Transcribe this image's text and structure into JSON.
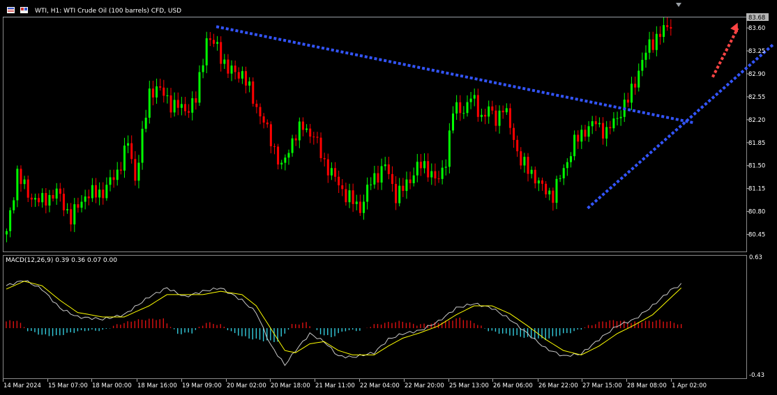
{
  "header": {
    "title": "WTI, H1:  WTI Crude Oil (100 barrels) CFD, USD"
  },
  "macd": {
    "label": "MACD(12,26,9) 0.39 0.36 0.07 0.00"
  },
  "colors": {
    "up": "#00ff00",
    "down": "#ff0000",
    "trendline": "#3355ff",
    "arrow": "#ff4444",
    "macd_line": "#c8c8c8",
    "signal_line": "#ffff00",
    "hist_pos": "#dd1111",
    "hist_neg": "#33ccdd"
  },
  "chart_data": [
    {
      "type": "candlestick",
      "title": "WTI, H1:  WTI Crude Oil (100 barrels) CFD, USD",
      "xlabel": "",
      "ylabel": "",
      "ylim": [
        80.2,
        83.75
      ],
      "y_ticks": [
        "83.60",
        "83.25",
        "82.90",
        "82.55",
        "82.20",
        "81.85",
        "81.50",
        "81.15",
        "80.80",
        "80.45"
      ],
      "y_tick_values": [
        83.6,
        83.25,
        82.9,
        82.55,
        82.2,
        81.85,
        81.5,
        81.15,
        80.8,
        80.45
      ],
      "current_price": "83.68",
      "x_tick_labels": [
        "14 Mar 2024",
        "15 Mar 07:00",
        "18 Mar 00:00",
        "18 Mar 16:00",
        "19 Mar 09:00",
        "20 Mar 02:00",
        "20 Mar 18:00",
        "21 Mar 11:00",
        "22 Mar 04:00",
        "22 Mar 20:00",
        "25 Mar 13:00",
        "26 Mar 06:00",
        "26 Mar 22:00",
        "27 Mar 15:00",
        "28 Mar 08:00",
        "1 Apr 02:00"
      ],
      "close_path": [
        [
          0,
          80.45
        ],
        [
          3,
          81.4
        ],
        [
          6,
          81.05
        ],
        [
          10,
          80.95
        ],
        [
          14,
          81.1
        ],
        [
          18,
          80.7
        ],
        [
          22,
          81.05
        ],
        [
          27,
          81.1
        ],
        [
          31,
          81.4
        ],
        [
          34,
          81.85
        ],
        [
          36,
          81.3
        ],
        [
          40,
          82.6
        ],
        [
          42,
          82.7
        ],
        [
          46,
          82.45
        ],
        [
          50,
          82.35
        ],
        [
          53,
          82.5
        ],
        [
          56,
          83.45
        ],
        [
          59,
          83.3
        ],
        [
          62,
          82.95
        ],
        [
          66,
          82.9
        ],
        [
          70,
          82.4
        ],
        [
          74,
          81.9
        ],
        [
          77,
          81.45
        ],
        [
          80,
          81.9
        ],
        [
          83,
          82.1
        ],
        [
          86,
          81.95
        ],
        [
          89,
          81.55
        ],
        [
          92,
          81.3
        ],
        [
          95,
          81.05
        ],
        [
          99,
          80.85
        ],
        [
          102,
          81.25
        ],
        [
          106,
          81.5
        ],
        [
          109,
          81.05
        ],
        [
          112,
          81.2
        ],
        [
          115,
          81.5
        ],
        [
          118,
          81.45
        ],
        [
          121,
          81.25
        ],
        [
          123,
          81.6
        ],
        [
          125,
          82.35
        ],
        [
          128,
          82.35
        ],
        [
          130,
          82.55
        ],
        [
          133,
          82.25
        ],
        [
          135,
          82.35
        ],
        [
          137,
          82.2
        ],
        [
          139,
          82.4
        ],
        [
          141,
          82.1
        ],
        [
          144,
          81.55
        ],
        [
          147,
          81.4
        ],
        [
          150,
          81.15
        ],
        [
          153,
          81.05
        ],
        [
          156,
          81.45
        ],
        [
          159,
          81.85
        ],
        [
          162,
          82.05
        ],
        [
          165,
          82.15
        ],
        [
          168,
          82.0
        ],
        [
          171,
          82.25
        ],
        [
          174,
          82.5
        ],
        [
          177,
          82.95
        ],
        [
          180,
          83.35
        ],
        [
          183,
          83.5
        ],
        [
          186,
          83.68
        ]
      ],
      "annotations": [
        {
          "type": "dotted-trendline",
          "color": "blue",
          "from": [
            59,
            83.62
          ],
          "to": [
            193,
            82.15
          ]
        },
        {
          "type": "dotted-trendline",
          "color": "blue",
          "from": [
            163,
            80.85
          ],
          "to": [
            215,
            83.35
          ]
        },
        {
          "type": "dotted-arrow",
          "color": "red",
          "from": [
            198,
            82.85
          ],
          "to": [
            205,
            83.68
          ],
          "direction": "up"
        }
      ]
    },
    {
      "type": "macd",
      "title": "MACD(12,26,9) 0.39 0.36 0.07 0.00",
      "ylim": [
        -0.43,
        0.63
      ],
      "y_ticks": [
        "0.63",
        "-0.43"
      ],
      "y_tick_values": [
        0.63,
        -0.43
      ],
      "values": {
        "macd": 0.39,
        "signal": 0.36,
        "histogram": 0.07,
        "extra": 0.0
      },
      "macd_path": [
        [
          0,
          0.38
        ],
        [
          5,
          0.43
        ],
        [
          10,
          0.35
        ],
        [
          15,
          0.18
        ],
        [
          20,
          0.1
        ],
        [
          27,
          0.08
        ],
        [
          33,
          0.12
        ],
        [
          40,
          0.28
        ],
        [
          45,
          0.36
        ],
        [
          50,
          0.28
        ],
        [
          55,
          0.33
        ],
        [
          60,
          0.36
        ],
        [
          66,
          0.25
        ],
        [
          70,
          0.14
        ],
        [
          74,
          -0.15
        ],
        [
          78,
          -0.33
        ],
        [
          81,
          -0.2
        ],
        [
          85,
          -0.05
        ],
        [
          89,
          -0.12
        ],
        [
          93,
          -0.25
        ],
        [
          97,
          -0.26
        ],
        [
          103,
          -0.22
        ],
        [
          107,
          -0.1
        ],
        [
          111,
          -0.05
        ],
        [
          116,
          -0.02
        ],
        [
          121,
          0.06
        ],
        [
          126,
          0.18
        ],
        [
          131,
          0.22
        ],
        [
          136,
          0.18
        ],
        [
          141,
          0.08
        ],
        [
          146,
          -0.05
        ],
        [
          151,
          -0.18
        ],
        [
          156,
          -0.25
        ],
        [
          161,
          -0.23
        ],
        [
          166,
          -0.1
        ],
        [
          171,
          0.02
        ],
        [
          176,
          0.08
        ],
        [
          181,
          0.2
        ],
        [
          186,
          0.34
        ],
        [
          189,
          0.39
        ]
      ],
      "signal_path": [
        [
          0,
          0.35
        ],
        [
          5,
          0.42
        ],
        [
          10,
          0.38
        ],
        [
          15,
          0.25
        ],
        [
          20,
          0.14
        ],
        [
          27,
          0.1
        ],
        [
          33,
          0.1
        ],
        [
          40,
          0.2
        ],
        [
          45,
          0.3
        ],
        [
          50,
          0.3
        ],
        [
          55,
          0.3
        ],
        [
          60,
          0.33
        ],
        [
          66,
          0.3
        ],
        [
          70,
          0.2
        ],
        [
          74,
          0.0
        ],
        [
          78,
          -0.2
        ],
        [
          81,
          -0.22
        ],
        [
          85,
          -0.14
        ],
        [
          89,
          -0.12
        ],
        [
          93,
          -0.2
        ],
        [
          97,
          -0.24
        ],
        [
          103,
          -0.24
        ],
        [
          107,
          -0.16
        ],
        [
          111,
          -0.09
        ],
        [
          116,
          -0.04
        ],
        [
          121,
          0.02
        ],
        [
          126,
          0.12
        ],
        [
          131,
          0.2
        ],
        [
          136,
          0.2
        ],
        [
          141,
          0.13
        ],
        [
          146,
          0.02
        ],
        [
          151,
          -0.1
        ],
        [
          156,
          -0.2
        ],
        [
          161,
          -0.24
        ],
        [
          166,
          -0.16
        ],
        [
          171,
          -0.05
        ],
        [
          176,
          0.03
        ],
        [
          181,
          0.12
        ],
        [
          186,
          0.27
        ],
        [
          189,
          0.36
        ]
      ],
      "histogram_sample": [
        [
          0,
          0.06
        ],
        [
          3,
          0.07
        ],
        [
          6,
          -0.02
        ],
        [
          10,
          -0.06
        ],
        [
          14,
          -0.07
        ],
        [
          18,
          -0.04
        ],
        [
          22,
          -0.02
        ],
        [
          27,
          -0.02
        ],
        [
          31,
          0.03
        ],
        [
          36,
          0.07
        ],
        [
          40,
          0.08
        ],
        [
          44,
          0.08
        ],
        [
          48,
          -0.05
        ],
        [
          52,
          -0.04
        ],
        [
          56,
          0.05
        ],
        [
          60,
          0.03
        ],
        [
          64,
          -0.05
        ],
        [
          68,
          -0.09
        ],
        [
          72,
          -0.11
        ],
        [
          76,
          -0.12
        ],
        [
          80,
          0.03
        ],
        [
          84,
          0.05
        ],
        [
          88,
          -0.05
        ],
        [
          91,
          -0.08
        ],
        [
          95,
          -0.02
        ],
        [
          99,
          -0.02
        ],
        [
          103,
          0.03
        ],
        [
          107,
          0.05
        ],
        [
          111,
          0.06
        ],
        [
          115,
          0.03
        ],
        [
          119,
          0.04
        ],
        [
          123,
          0.06
        ],
        [
          127,
          0.09
        ],
        [
          131,
          0.05
        ],
        [
          135,
          -0.02
        ],
        [
          139,
          -0.05
        ],
        [
          143,
          -0.07
        ],
        [
          147,
          -0.09
        ],
        [
          151,
          -0.1
        ],
        [
          155,
          -0.06
        ],
        [
          159,
          -0.03
        ],
        [
          163,
          0.02
        ],
        [
          167,
          0.06
        ],
        [
          171,
          0.07
        ],
        [
          175,
          0.05
        ],
        [
          179,
          0.06
        ],
        [
          183,
          0.07
        ],
        [
          187,
          0.05
        ],
        [
          189,
          0.03
        ]
      ]
    }
  ]
}
